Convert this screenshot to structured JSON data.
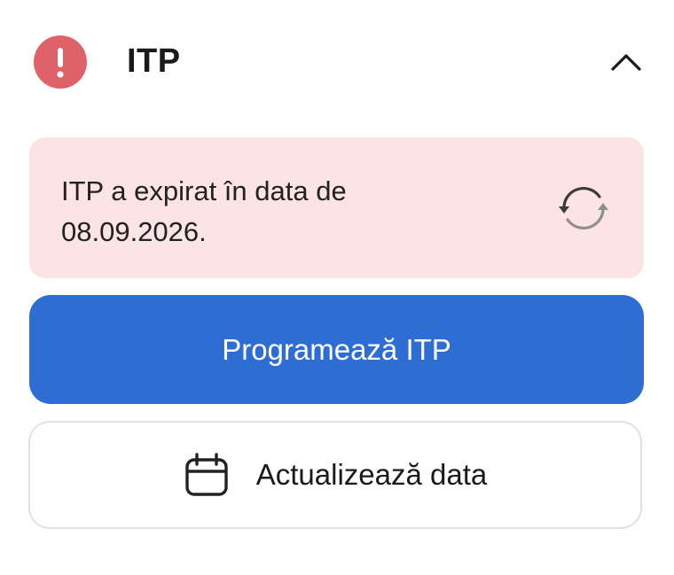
{
  "header": {
    "title": "ITP",
    "status_icon": "exclamation-icon",
    "status_color": "#e06269",
    "toggle_icon": "chevron-up-icon"
  },
  "notice": {
    "line1": "ITP a expirat în data de",
    "line2": "08.09.2026.",
    "background": "#fce3e4",
    "action_icon": "refresh-icon"
  },
  "actions": {
    "primary_label": "Programează ITP",
    "primary_color": "#2e6dd3",
    "secondary_label": "Actualizează data",
    "secondary_icon": "calendar-icon"
  }
}
